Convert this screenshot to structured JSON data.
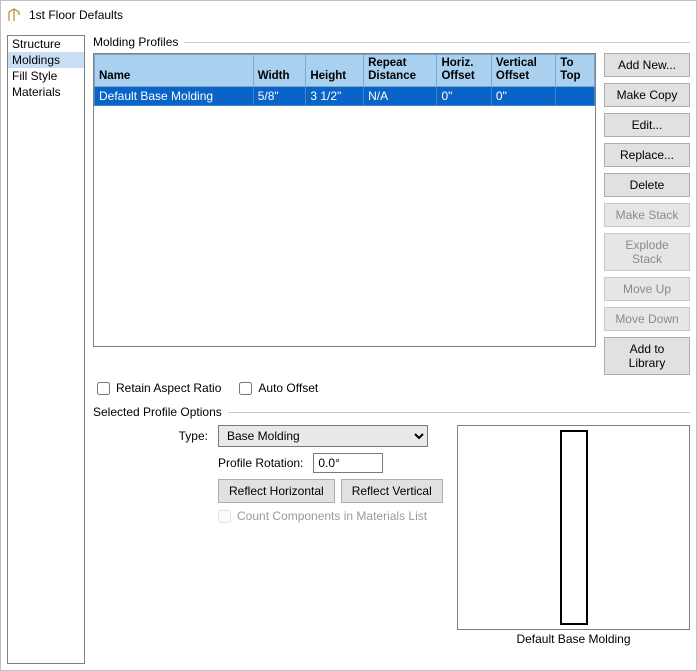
{
  "window": {
    "title": "1st Floor Defaults"
  },
  "sidebar": {
    "items": [
      {
        "label": "Structure"
      },
      {
        "label": "Moldings"
      },
      {
        "label": "Fill Style"
      },
      {
        "label": "Materials"
      }
    ],
    "selected_index": 1
  },
  "profiles": {
    "group_label": "Molding Profiles",
    "columns": [
      "Name",
      "Width",
      "Height",
      "Repeat Distance",
      "Horiz. Offset",
      "Vertical Offset",
      "To Top"
    ],
    "rows": [
      {
        "name": "Default Base Molding",
        "width": "5/8\"",
        "height": "3 1/2\"",
        "repeat": "N/A",
        "hoff": "0\"",
        "voff": "0\"",
        "totop": ""
      }
    ],
    "buttons": {
      "add_new": "Add New...",
      "make_copy": "Make Copy",
      "edit": "Edit...",
      "replace": "Replace...",
      "delete": "Delete",
      "make_stack": "Make Stack",
      "explode_stack": "Explode Stack",
      "move_up": "Move Up",
      "move_down": "Move Down",
      "add_to_library": "Add to Library"
    },
    "retain_label": "Retain Aspect Ratio",
    "auto_offset_label": "Auto Offset",
    "retain_checked": false,
    "auto_offset_checked": false
  },
  "selected_profile": {
    "group_label": "Selected Profile Options",
    "type_label": "Type:",
    "type_value": "Base Molding",
    "rotation_label": "Profile Rotation:",
    "rotation_value": "0.0°",
    "reflect_h": "Reflect Horizontal",
    "reflect_v": "Reflect Vertical",
    "count_label": "Count Components in Materials List",
    "preview_label": "Default Base Molding"
  }
}
